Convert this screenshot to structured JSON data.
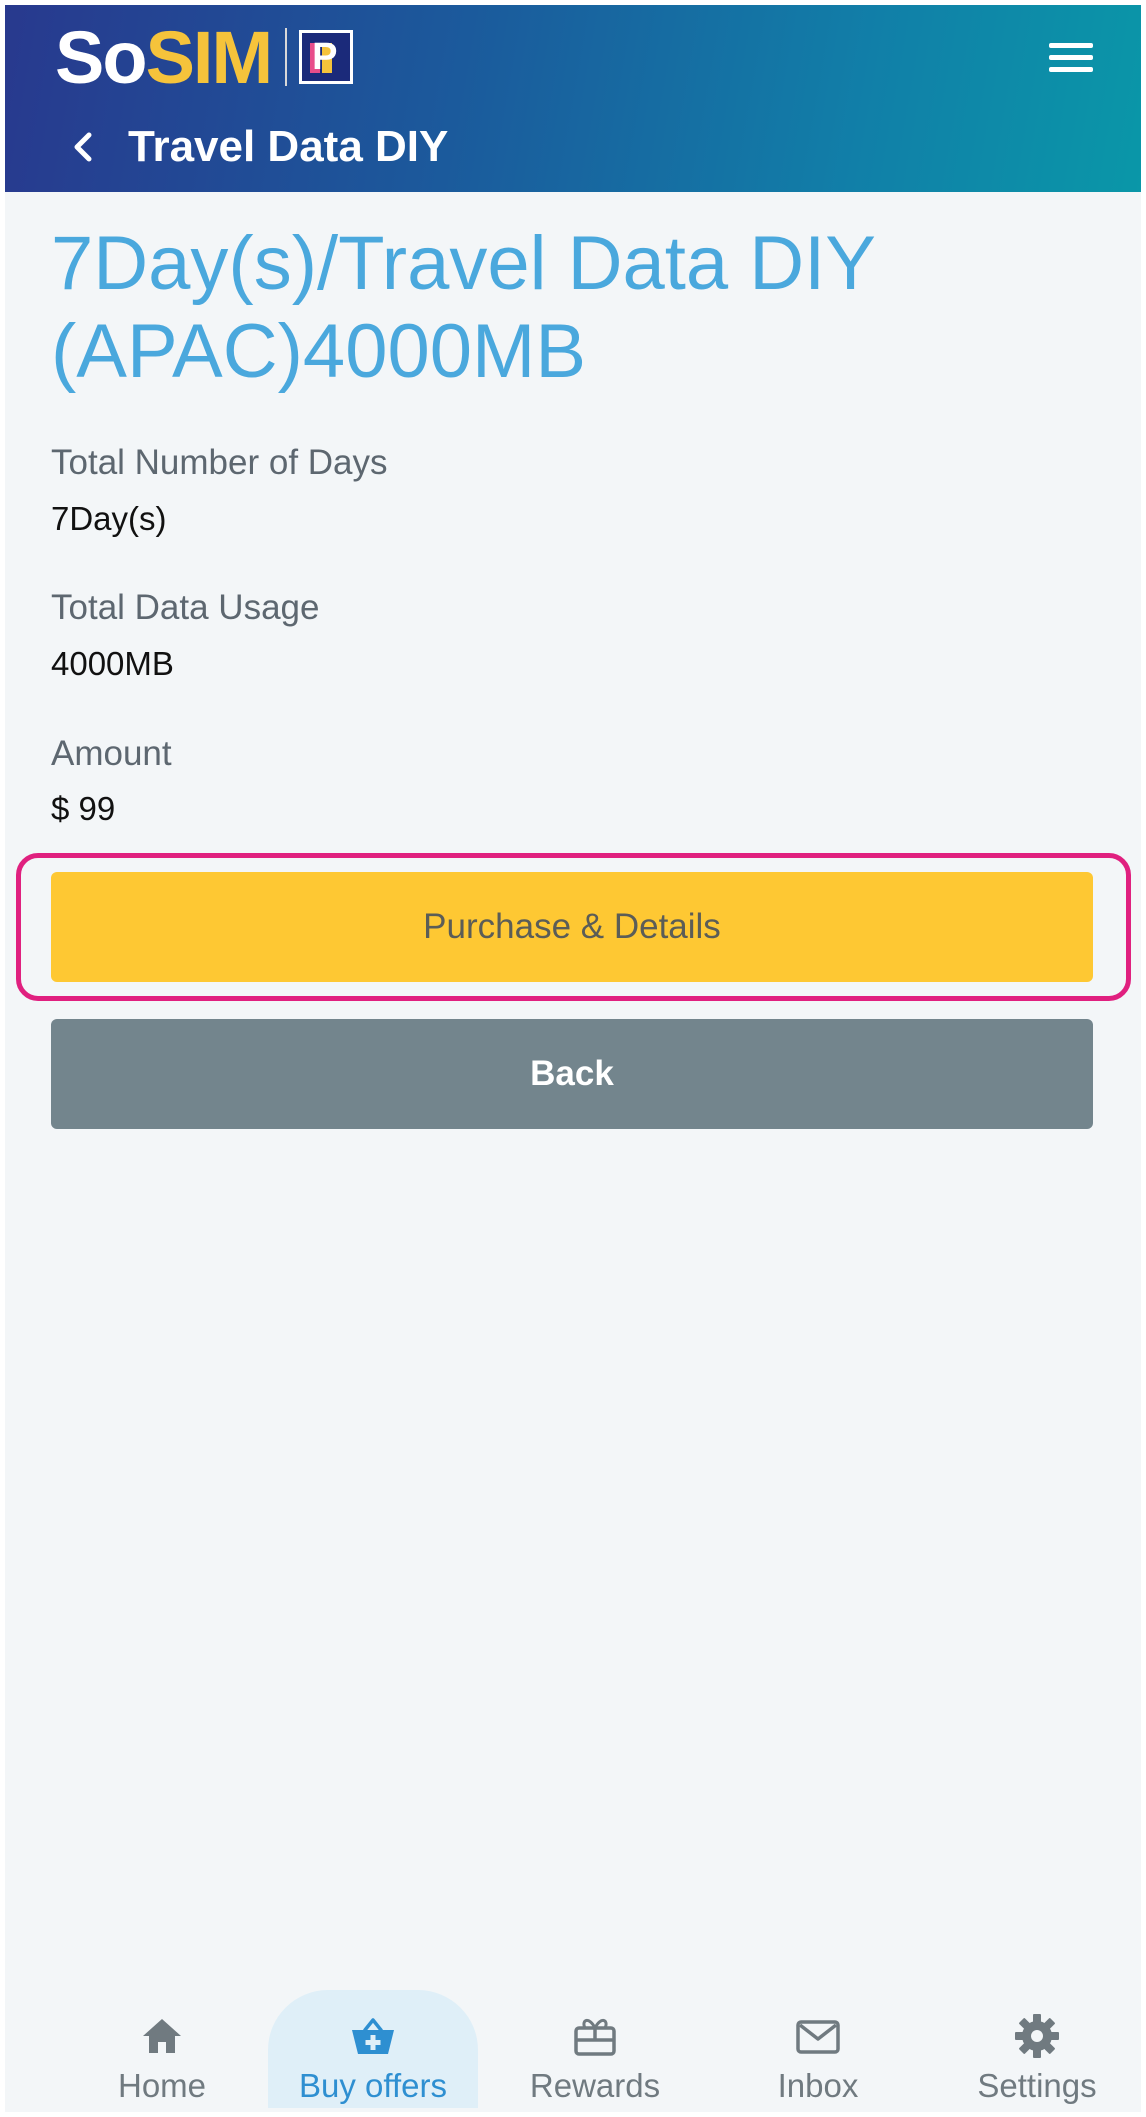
{
  "header": {
    "logo_so": "So",
    "logo_sim": "SIM",
    "logo_badge": "P",
    "title": "Travel Data DIY"
  },
  "main": {
    "title": "7Day(s)/Travel Data DIY (APAC)4000MB",
    "fields": [
      {
        "label": "Total Number of Days",
        "value": "7Day(s)"
      },
      {
        "label": "Total Data Usage",
        "value": "4000MB"
      },
      {
        "label": "Amount",
        "value": "$ 99"
      }
    ],
    "purchase_label": "Purchase & Details",
    "back_label": "Back"
  },
  "bottom_nav": {
    "items": [
      {
        "label": "Home",
        "icon": "home-icon",
        "active": false
      },
      {
        "label": "Buy offers",
        "icon": "basket-plus-icon",
        "active": true
      },
      {
        "label": "Rewards",
        "icon": "gift-icon",
        "active": false
      },
      {
        "label": "Inbox",
        "icon": "mail-icon",
        "active": false
      },
      {
        "label": "Settings",
        "icon": "gear-icon",
        "active": false
      }
    ]
  },
  "colors": {
    "title_blue": "#4aa8dd",
    "button_yellow": "#fec833",
    "button_gray": "#73858d",
    "highlight_pink": "#e0207f",
    "nav_active": "#2e8fd1"
  }
}
